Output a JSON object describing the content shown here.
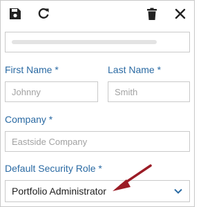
{
  "toolbar": {
    "icons": [
      "save-icon",
      "refresh-icon",
      "delete-icon",
      "close-icon"
    ]
  },
  "email": {
    "value": ""
  },
  "first_name": {
    "label": "First Name *",
    "placeholder": "Johnny"
  },
  "last_name": {
    "label": "Last Name *",
    "placeholder": "Smith"
  },
  "company": {
    "label": "Company *",
    "placeholder": "Eastside Company"
  },
  "security_role": {
    "label": "Default Security Role *",
    "value": "Portfolio Administrator"
  },
  "colors": {
    "label": "#2a6aa3",
    "annotation_arrow": "#9b1c26",
    "icon": "#222222"
  }
}
